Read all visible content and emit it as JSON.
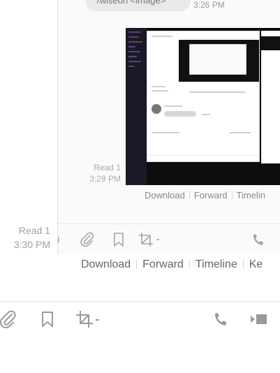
{
  "nested_panel": {
    "bubble_text": "/wiseon <image>",
    "bubble_time": "3:26 PM",
    "read_receipt": {
      "line1": "Read 1",
      "line2": "3:29 PM"
    },
    "actions": {
      "download": "Download",
      "forward": "Forward",
      "timeline": "Timelin"
    }
  },
  "message": {
    "read_receipt": {
      "line1": "Read 1",
      "line2": "3:30 PM"
    },
    "actions": {
      "download": "Download",
      "forward": "Forward",
      "timeline": "Timeline",
      "keep": "Ke"
    }
  },
  "toolbar": {
    "icons": [
      "attach-icon",
      "bookmark-icon",
      "crop-icon",
      "chevron-down-icon",
      "phone-icon",
      "video-icon"
    ]
  },
  "colors": {
    "link_text": "#666666",
    "muted_text": "#a0a0a0",
    "icon": "#9a9a9a",
    "background": "#ffffff"
  }
}
